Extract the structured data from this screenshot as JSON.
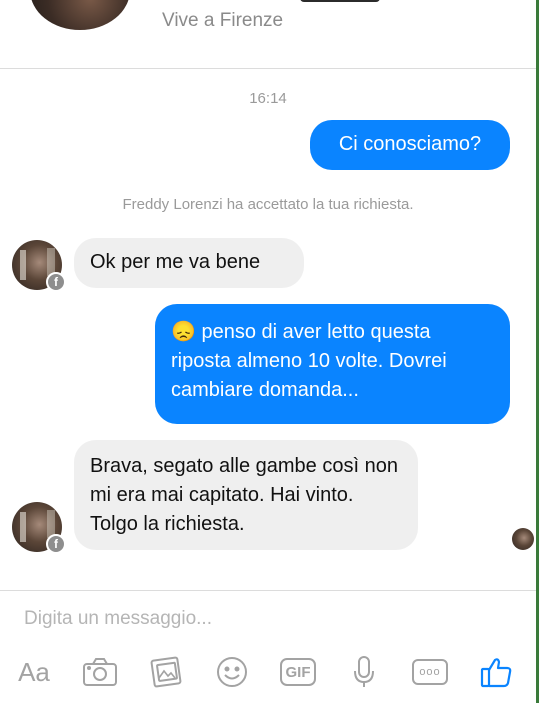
{
  "header": {
    "subtitle": "Vive a Firenze"
  },
  "thread": {
    "timestamp": "16:14",
    "messages": [
      {
        "side": "out",
        "text": "Ci conosciamo?"
      },
      {
        "side": "system",
        "text": "Freddy Lorenzi ha accettato la tua richiesta."
      },
      {
        "side": "in",
        "text": "Ok per me va bene"
      },
      {
        "side": "out",
        "emoji": "😞",
        "text": " penso di aver letto questa riposta almeno 10 volte. Dovrei cambiare domanda..."
      },
      {
        "side": "in",
        "text": "Brava, segato alle gambe così non mi era mai capitato. Hai vinto. Tolgo la richiesta."
      }
    ]
  },
  "composer": {
    "placeholder": "Digita un messaggio...",
    "aa_label": "Aa",
    "gif_label": "GIF",
    "more_label": "ooo"
  },
  "badge": {
    "letter": "f"
  },
  "colors": {
    "outgoing": "#0a84ff",
    "incoming": "#efefef",
    "like": "#0a84ff",
    "icons": "#a3a3a3"
  },
  "icons": [
    "camera-icon",
    "gallery-icon",
    "emoji-icon",
    "gif-icon",
    "microphone-icon",
    "more-icon",
    "like-icon"
  ]
}
